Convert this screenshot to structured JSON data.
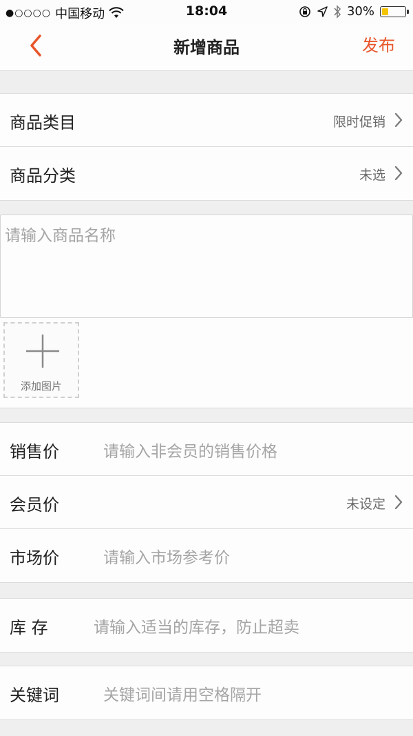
{
  "status_bar": {
    "signal": "●○○○○",
    "carrier": "中国移动",
    "time": "18:04",
    "battery": "30%",
    "battery_level": 0.3,
    "icons": [
      "wifi-icon",
      "rotation-lock-icon",
      "location-icon",
      "bluetooth-icon",
      "battery-icon"
    ]
  },
  "nav": {
    "title": "新增商品",
    "publish_label": "发布",
    "accent_color": "#e8552a"
  },
  "category_group": {
    "items": [
      {
        "label": "商品类目",
        "value": "限时促销"
      },
      {
        "label": "商品分类",
        "value": "未选"
      }
    ]
  },
  "product_name": {
    "placeholder": "请输入商品名称"
  },
  "photo": {
    "add_label": "添加图片"
  },
  "price_group": {
    "sale_price": {
      "label": "销售价",
      "placeholder": "请输入非会员的销售价格"
    },
    "member_price": {
      "label": "会员价",
      "value": "未设定"
    },
    "market_price": {
      "label": "市场价",
      "placeholder": "请输入市场参考价"
    }
  },
  "stock": {
    "label": "库 存",
    "placeholder": "请输入适当的库存，防止超卖"
  },
  "keywords": {
    "label": "关键词",
    "placeholder": "关键词间请用空格隔开"
  }
}
